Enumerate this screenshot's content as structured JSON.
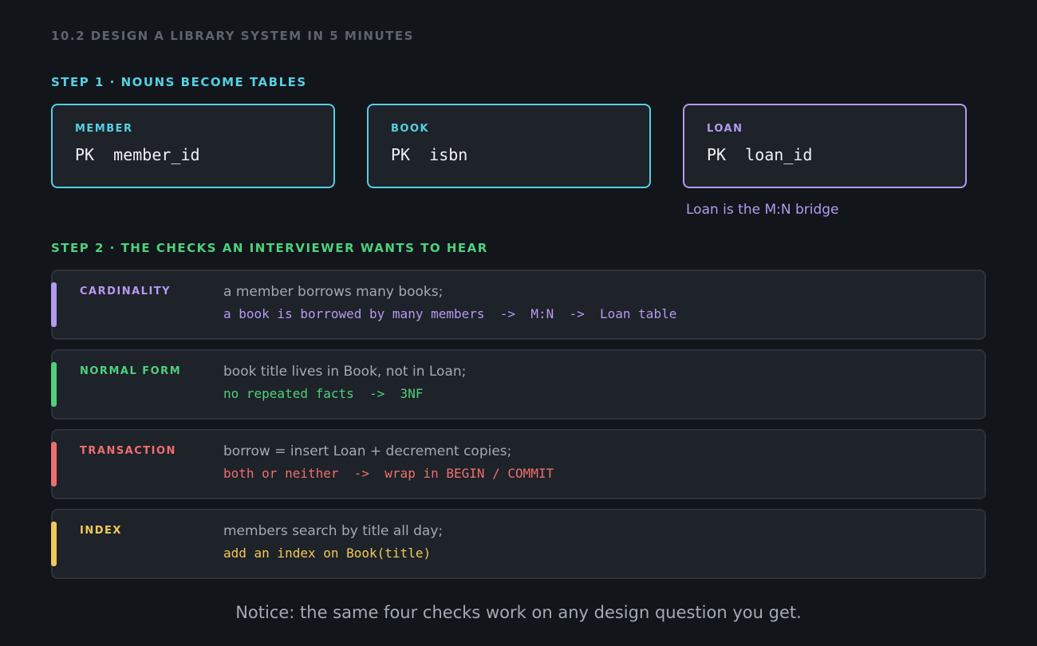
{
  "page_title": "10.2  DESIGN A LIBRARY SYSTEM IN 5 MINUTES",
  "step1": {
    "title": "STEP 1  ·  NOUNS BECOME TABLES",
    "tables": [
      {
        "name": "MEMBER",
        "pk": "PK  member_id"
      },
      {
        "name": "BOOK",
        "pk": "PK  isbn"
      },
      {
        "name": "LOAN",
        "pk": "PK  loan_id"
      }
    ],
    "bridge_note": "Loan is the M:N bridge"
  },
  "step2": {
    "title": "STEP 2  ·  THE CHECKS AN INTERVIEWER WANTS TO HEAR",
    "checks": [
      {
        "label": "CARDINALITY",
        "desc": "a member borrows many books;",
        "code": "a book is borrowed by many members  ->  M:N  ->  Loan table",
        "color": "#b49af0"
      },
      {
        "label": "NORMAL FORM",
        "desc": "book title lives in Book, not in Loan;",
        "code": "no repeated facts  ->  3NF",
        "color": "#4ed07e"
      },
      {
        "label": "TRANSACTION",
        "desc": "borrow = insert Loan + decrement copies;",
        "code": "both or neither  ->  wrap in BEGIN / COMMIT",
        "color": "#ee6f6f"
      },
      {
        "label": "INDEX",
        "desc": "members search by title all day;",
        "code": "add an index on Book(title)",
        "color": "#f2c85a"
      }
    ]
  },
  "footer_note": "Notice: the same four checks work on any design question you get.",
  "colors": {
    "background": "#12151a",
    "card": "#1e2229",
    "cyan_accent": "#56cfe3",
    "purple_accent": "#b49af0",
    "green_accent": "#4ed07e",
    "red_accent": "#ee6f6f",
    "yellow_accent": "#f2c85a"
  }
}
